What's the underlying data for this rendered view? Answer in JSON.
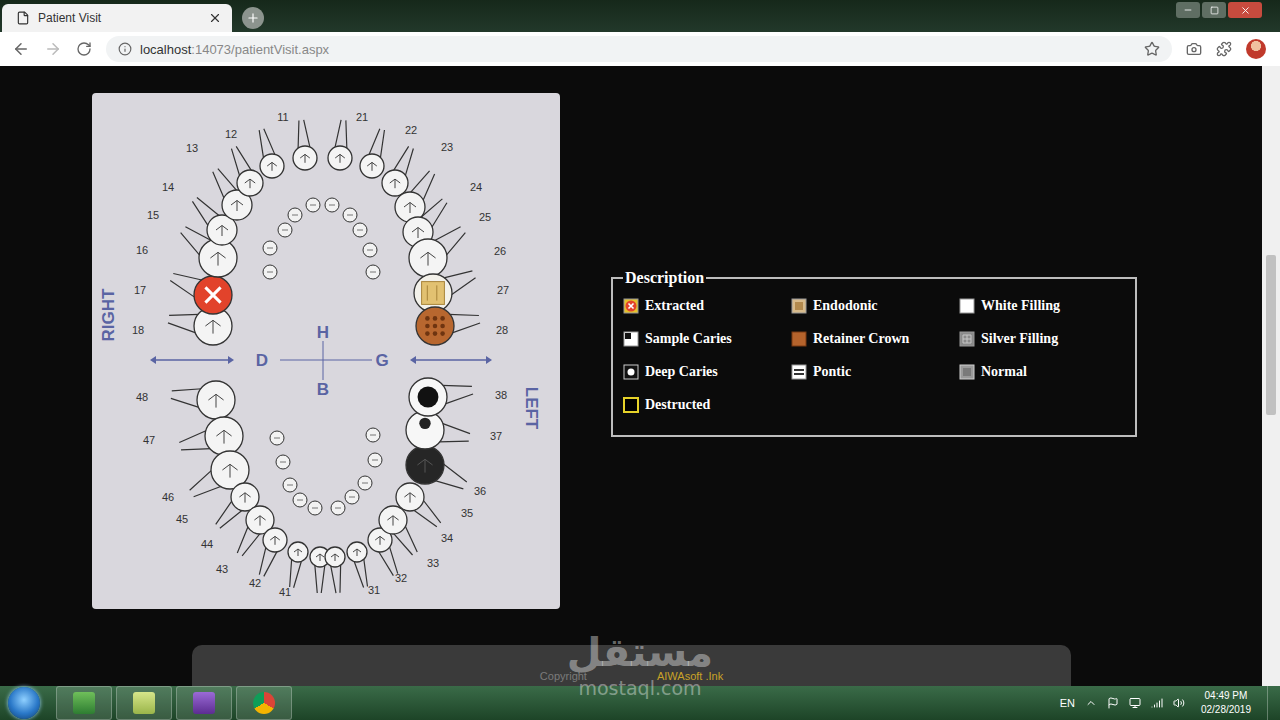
{
  "browser": {
    "tabs": [
      {
        "label": "Patient Visit",
        "selected": true
      }
    ],
    "address": {
      "host": "localhost",
      "path": ":14073/patientVisit.aspx"
    }
  },
  "chart": {
    "upper": [
      {
        "number": "18",
        "state": "normal"
      },
      {
        "number": "17",
        "state": "extracted"
      },
      {
        "number": "16",
        "state": "normal"
      },
      {
        "number": "15",
        "state": "normal"
      },
      {
        "number": "14",
        "state": "normal"
      },
      {
        "number": "13",
        "state": "normal"
      },
      {
        "number": "12",
        "state": "normal"
      },
      {
        "number": "11",
        "state": "normal"
      },
      {
        "number": "21",
        "state": "normal"
      },
      {
        "number": "22",
        "state": "normal"
      },
      {
        "number": "23",
        "state": "normal"
      },
      {
        "number": "24",
        "state": "normal"
      },
      {
        "number": "25",
        "state": "normal"
      },
      {
        "number": "26",
        "state": "normal"
      },
      {
        "number": "27",
        "state": "endodonic"
      },
      {
        "number": "28",
        "state": "retainer-crown"
      }
    ],
    "lower": [
      {
        "number": "48",
        "state": "normal"
      },
      {
        "number": "47",
        "state": "normal"
      },
      {
        "number": "46",
        "state": "normal"
      },
      {
        "number": "45",
        "state": "normal"
      },
      {
        "number": "44",
        "state": "normal"
      },
      {
        "number": "43",
        "state": "normal"
      },
      {
        "number": "42",
        "state": "normal"
      },
      {
        "number": "41",
        "state": "normal"
      },
      {
        "number": "31",
        "state": "normal"
      },
      {
        "number": "32",
        "state": "normal"
      },
      {
        "number": "33",
        "state": "normal"
      },
      {
        "number": "34",
        "state": "normal"
      },
      {
        "number": "35",
        "state": "normal"
      },
      {
        "number": "36",
        "state": "silver-filling"
      },
      {
        "number": "37",
        "state": "sample-caries"
      },
      {
        "number": "38",
        "state": "deep-caries"
      }
    ],
    "sides": {
      "right": "RIGHT",
      "left": "LEFT"
    },
    "axis": {
      "h": "H",
      "d": "D",
      "g": "G",
      "b": "B"
    }
  },
  "legend": {
    "title": "Description",
    "items": [
      {
        "label": "Extracted",
        "kind": "extracted"
      },
      {
        "label": "Endodonic",
        "kind": "endodonic"
      },
      {
        "label": "White Filling",
        "kind": "white-filling"
      },
      {
        "label": "Sample Caries",
        "kind": "sample-caries"
      },
      {
        "label": "Retainer Crown",
        "kind": "retainer-crown"
      },
      {
        "label": "Silver Filling",
        "kind": "silver-filling"
      },
      {
        "label": "Deep Caries",
        "kind": "deep-caries"
      },
      {
        "label": "Pontic",
        "kind": "pontic"
      },
      {
        "label": "Normal",
        "kind": "normal"
      },
      {
        "label": "Destructed",
        "kind": "destructed"
      }
    ]
  },
  "footer": {
    "copyright": "Copyright",
    "brand": "AIWAsoft .Ink"
  },
  "watermark": {
    "arabic": "مستقل",
    "latin": "mostaql.com"
  },
  "taskbar": {
    "language": "EN",
    "time": "04:49 PM",
    "date": "02/28/2019"
  }
}
